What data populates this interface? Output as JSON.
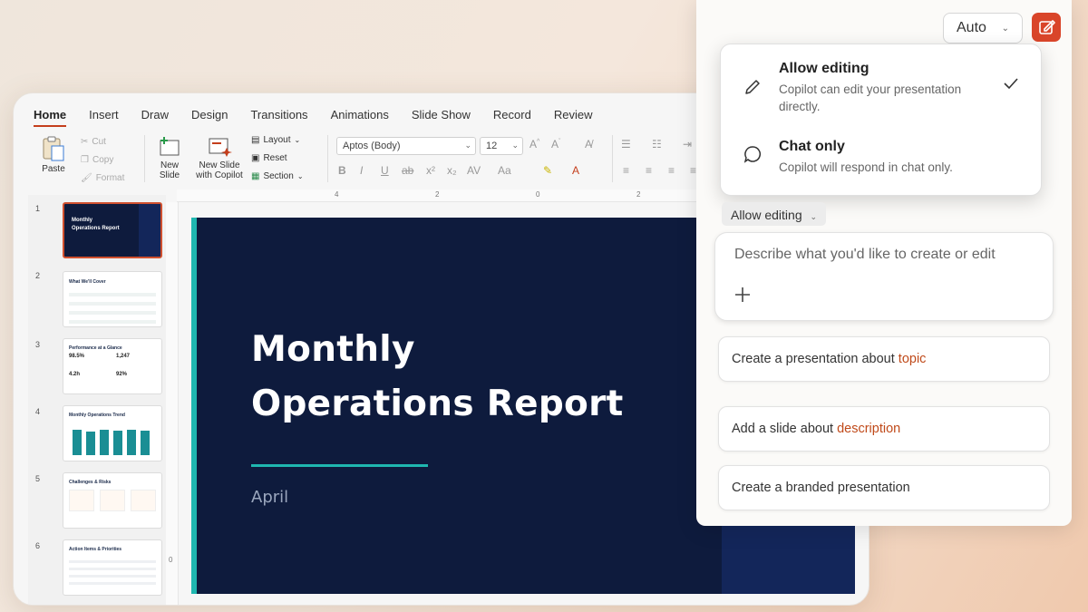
{
  "ribbon_tabs": [
    "Home",
    "Insert",
    "Draw",
    "Design",
    "Transitions",
    "Animations",
    "Slide Show",
    "Record",
    "Review"
  ],
  "ribbon": {
    "paste": "Paste",
    "cut": "Cut",
    "copy": "Copy",
    "format": "Format",
    "new_slide": "New\nSlide",
    "new_slide_l1": "New",
    "new_slide_l2": "Slide",
    "new_slide_copilot_l1": "New Slide",
    "new_slide_copilot_l2": "with Copilot",
    "layout": "Layout",
    "reset": "Reset",
    "section": "Section",
    "font_name": "Aptos (Body)",
    "font_size": "12"
  },
  "rulers": {
    "h_marks": [
      "4",
      "2",
      "0",
      "2",
      "4"
    ],
    "v_zero": "0"
  },
  "thumbnails": [
    {
      "num": "1",
      "title": "Monthly\nOperations Report"
    },
    {
      "num": "2",
      "title": "What We'll Cover"
    },
    {
      "num": "3",
      "title": "Performance at a Glance",
      "stats": [
        "98.5%",
        "1,247",
        "4.2h",
        "92%"
      ]
    },
    {
      "num": "4",
      "title": "Monthly Operations Trend"
    },
    {
      "num": "5",
      "title": "Challenges & Risks"
    },
    {
      "num": "6",
      "title": "Action Items & Priorities"
    }
  ],
  "slide": {
    "title_line1": "Monthly",
    "title_line2": "Operations Report",
    "subtitle": "April"
  },
  "copilot": {
    "mode_dropdown": "Auto",
    "menu": [
      {
        "title": "Allow editing",
        "desc": "Copilot can edit your presentation directly.",
        "checked": true
      },
      {
        "title": "Chat only",
        "desc": "Copilot will respond in chat only.",
        "checked": false
      }
    ],
    "current_mode": "Allow editing",
    "input_placeholder": "Describe what you'd like to create or edit",
    "suggestions": [
      {
        "prefix": "Create a presentation about ",
        "highlight": "topic"
      },
      {
        "prefix": "Add a slide about ",
        "highlight": "description"
      },
      {
        "prefix": "Create a branded presentation",
        "highlight": ""
      }
    ]
  },
  "colors": {
    "accent": "#d9452a",
    "slide_bg": "#0e1b3d",
    "slide_accent": "#1fb7b0",
    "highlight_text": "#c04a1a"
  }
}
